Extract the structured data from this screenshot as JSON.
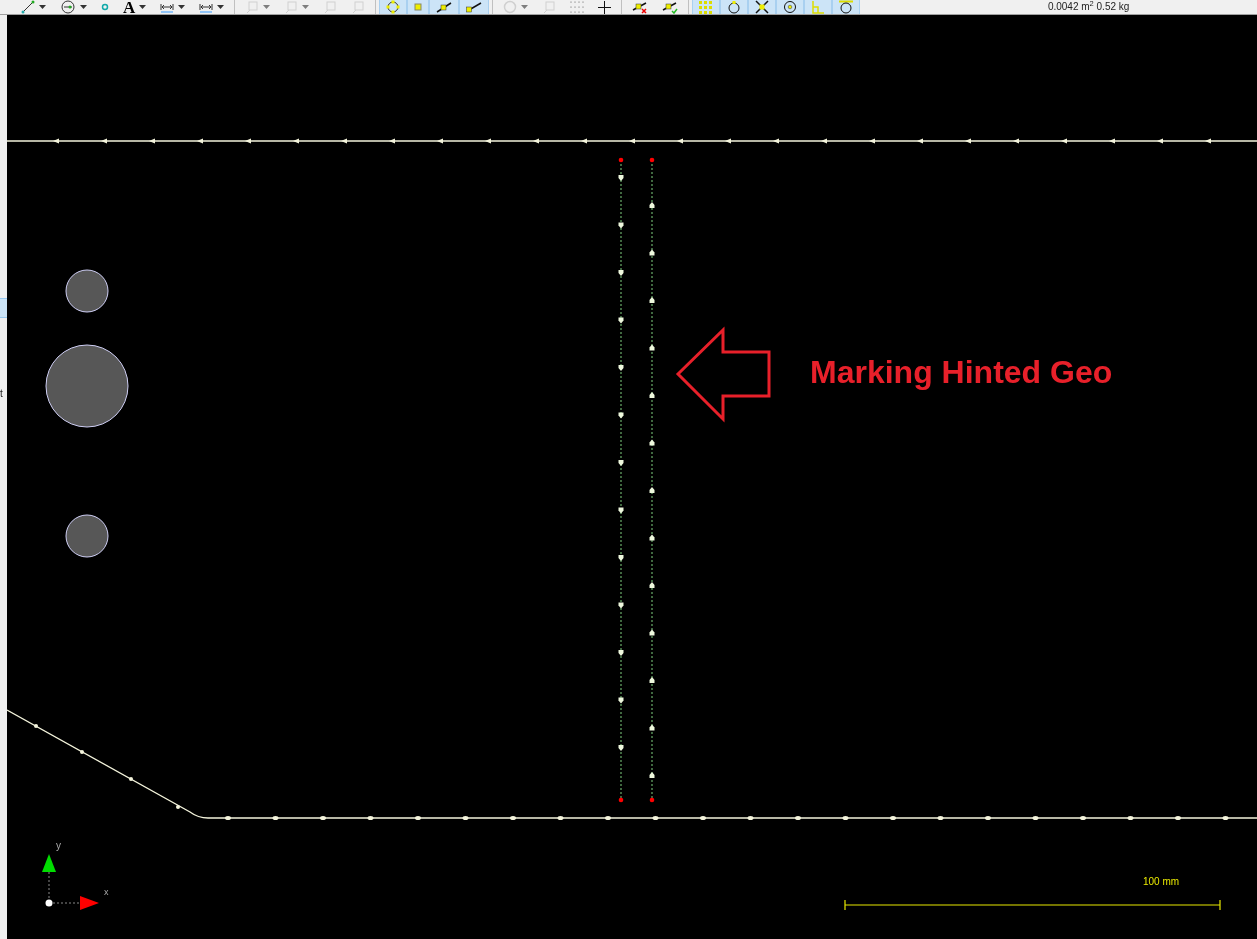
{
  "toolbar": {
    "groups": [
      {
        "items": [
          {
            "kind": "line",
            "selected": false,
            "disabled": false,
            "dropdown": true
          },
          {
            "kind": "circle-point",
            "selected": false,
            "disabled": false,
            "dropdown": true
          },
          {
            "kind": "point",
            "selected": false,
            "disabled": false,
            "dropdown": false
          },
          {
            "kind": "text",
            "label": "A",
            "selected": false,
            "disabled": false,
            "dropdown": true
          },
          {
            "kind": "dimension",
            "selected": false,
            "disabled": false,
            "dropdown": true
          },
          {
            "kind": "dimension",
            "selected": false,
            "disabled": false,
            "dropdown": true
          }
        ]
      },
      {
        "items": [
          {
            "kind": "frame",
            "selected": false,
            "disabled": true,
            "dropdown": true
          },
          {
            "kind": "frame",
            "selected": false,
            "disabled": true,
            "dropdown": true
          },
          {
            "kind": "frame",
            "selected": false,
            "disabled": true,
            "dropdown": false
          },
          {
            "kind": "frame",
            "selected": false,
            "disabled": true,
            "dropdown": false
          }
        ]
      },
      {
        "items": [
          {
            "kind": "snap-circle",
            "selected": true,
            "disabled": false,
            "dropdown": false
          },
          {
            "kind": "snap-square",
            "selected": true,
            "disabled": false,
            "dropdown": false
          },
          {
            "kind": "snap-mid",
            "selected": true,
            "disabled": false,
            "dropdown": false
          },
          {
            "kind": "snap-end",
            "selected": true,
            "disabled": false,
            "dropdown": false
          }
        ]
      },
      {
        "items": [
          {
            "kind": "ring",
            "selected": false,
            "disabled": true,
            "dropdown": true
          },
          {
            "kind": "frame",
            "selected": false,
            "disabled": true,
            "dropdown": false
          },
          {
            "kind": "dots",
            "selected": false,
            "disabled": false,
            "dropdown": false
          },
          {
            "kind": "plus",
            "selected": false,
            "disabled": false,
            "dropdown": false
          }
        ]
      },
      {
        "items": [
          {
            "kind": "reject",
            "selected": false,
            "disabled": false,
            "dropdown": false
          },
          {
            "kind": "accept",
            "selected": false,
            "disabled": false,
            "dropdown": false
          }
        ]
      },
      {
        "items": [
          {
            "kind": "grid",
            "selected": true,
            "disabled": false,
            "dropdown": false
          },
          {
            "kind": "quadrant",
            "selected": true,
            "disabled": false,
            "dropdown": false
          },
          {
            "kind": "intersection",
            "selected": true,
            "disabled": false,
            "dropdown": false
          },
          {
            "kind": "center",
            "selected": true,
            "disabled": false,
            "dropdown": false
          },
          {
            "kind": "perpendicular",
            "selected": true,
            "disabled": false,
            "dropdown": false
          },
          {
            "kind": "tangent",
            "selected": true,
            "disabled": false,
            "dropdown": false
          }
        ]
      }
    ],
    "status": "0.0042 m$^{2}$  0.52 kg"
  },
  "side_panel": {
    "text": "t"
  },
  "canvas": {
    "annotation": "Marking Hinted Geo",
    "scale_label": "100 mm",
    "axis_y": "y",
    "axis_x": "x"
  }
}
